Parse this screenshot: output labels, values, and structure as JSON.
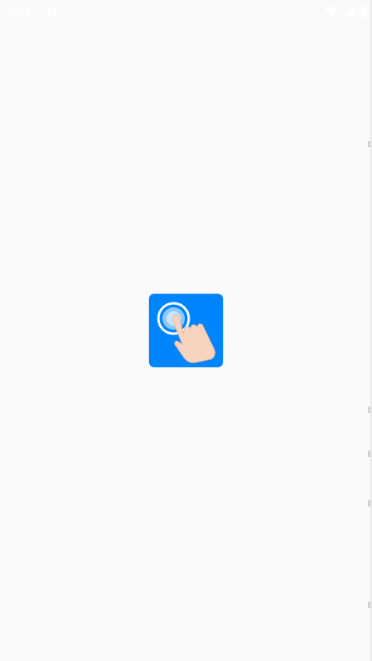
{
  "status_bar": {
    "time": "8:51",
    "icons": [
      "notification-icon",
      "wifi-icon",
      "signal-icon",
      "battery-icon"
    ]
  },
  "splash": {
    "icon": "tap-finger-icon",
    "icon_bg_color": "#0185fd"
  },
  "colors": {
    "background": "#fafafa",
    "accent": "#0185fd",
    "status_text": "#ffffff"
  }
}
